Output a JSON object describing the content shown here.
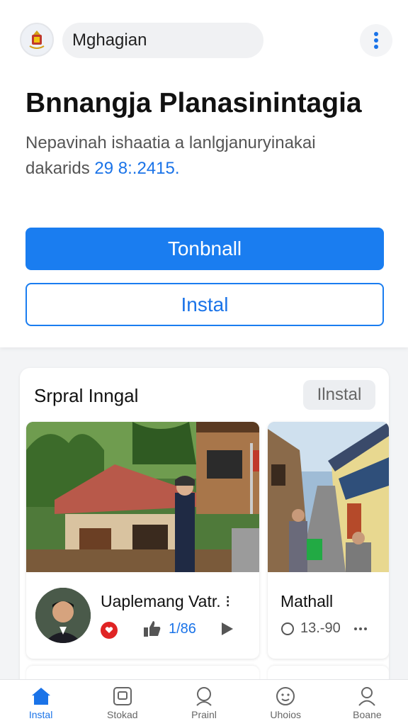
{
  "header": {
    "search_text": "Mghagian",
    "logo_icon": "emblem-icon",
    "more_icon": "more-vertical-icon"
  },
  "hero": {
    "title": "Bnnangja Planasinintagia",
    "description_line1": "Nepavinah ishaatia a lanlgjanuryinakai",
    "description_prefix": "dakarids",
    "description_number": "29 8:.2415."
  },
  "buttons": {
    "primary_label": "Tonbnall",
    "outline_label": "Instal"
  },
  "section": {
    "title": "Srpral Inngal",
    "action_label": "Ilnstal",
    "items": [
      {
        "name": "Uaplemang Vatr. ⁝",
        "likes": "1/86",
        "image": "house-photo"
      },
      {
        "name": "Mathall",
        "views": "13.-90",
        "image": "street-photo"
      }
    ]
  },
  "bottom_nav": [
    {
      "label": "Instal",
      "icon": "home-icon",
      "active": true
    },
    {
      "label": "Stokad",
      "icon": "square-icon",
      "active": false
    },
    {
      "label": "Prainl",
      "icon": "search-person-icon",
      "active": false
    },
    {
      "label": "Uhoios",
      "icon": "face-icon",
      "active": false
    },
    {
      "label": "Boane",
      "icon": "profile-icon",
      "active": false
    }
  ],
  "colors": {
    "accent": "#1a7df0",
    "background": "#f3f4f6",
    "badge_red": "#e02424"
  }
}
